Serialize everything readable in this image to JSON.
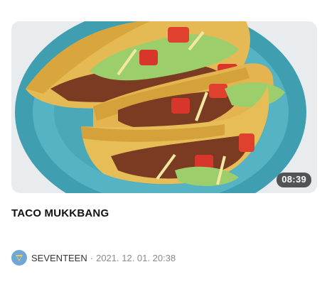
{
  "video": {
    "duration": "08:39",
    "title": "TACO MUKKBANG",
    "thumbnail_icon": "taco-thumbnail"
  },
  "channel": {
    "name": "SEVENTEEN",
    "avatar_icon": "seventeen-logo-icon",
    "separator": "·",
    "date": "2021. 12. 01. 20:38"
  }
}
